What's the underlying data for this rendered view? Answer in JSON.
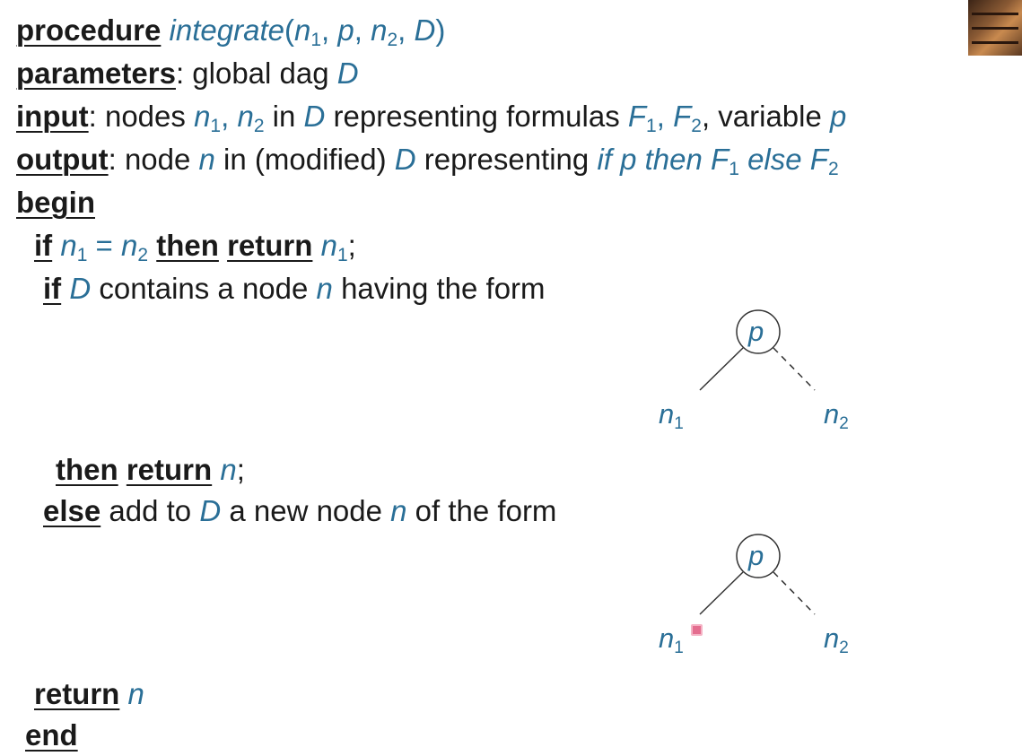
{
  "header": {
    "kw_procedure": "procedure",
    "proc_name": "integrate",
    "kw_parameters": "parameters",
    "parameters_text": ": global dag ",
    "dag": "D",
    "kw_input": "input",
    "input_text": ": nodes ",
    "in_text": " in ",
    "representing_text": " representing formulas ",
    "variable_text": ", variable ",
    "kw_output": "output",
    "output_text": ": node ",
    "in_modified_text": " in (modified) ",
    "representing2_text": " representing ",
    "kw_begin": "begin"
  },
  "body": {
    "kw_if": "if",
    "kw_then": "then",
    "kw_return": "return",
    "kw_else": "else",
    "kw_end": "end",
    "contains_text": " contains a node ",
    "having_text": " having the form",
    "add_text": " add to ",
    "new_node_text": " a new node ",
    "of_form_text": " of the form",
    "semicolon": ";",
    "eq": " = "
  },
  "symbols": {
    "n": "n",
    "p": "p",
    "D": "D",
    "F": "F",
    "if_it": "if",
    "then_it": "then",
    "else_it": "else",
    "sub1": "1",
    "sub2": "2"
  },
  "diagrams": [
    {
      "root": "p",
      "left": "n",
      "left_sub": "1",
      "right": "n",
      "right_sub": "2"
    },
    {
      "root": "p",
      "left": "n",
      "left_sub": "1",
      "right": "n",
      "right_sub": "2"
    }
  ],
  "colors": {
    "math": "#2a6f97",
    "text": "#1a1a1a",
    "cursor": "#e46d8f"
  }
}
